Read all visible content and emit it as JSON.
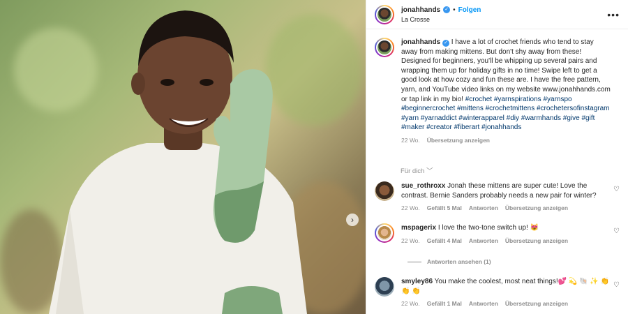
{
  "post": {
    "username": "jonahhands",
    "follow_label": "Folgen",
    "location": "La Crosse",
    "more_label": "•••",
    "caption_parts": {
      "text": "I have a lot of crochet friends who tend to stay away from making mittens. But don't shy away from these! Designed for beginners, you'll be whipping up several pairs and wrapping them up for holiday gifts in no time! Swipe left to get a good look at how cozy and fun these are. I have the free pattern, yarn, and YouTube video links on my website www.jonahhands.com or tap link in my bio!",
      "hashtags": "#crochet #yarnspirations #yarnspo #beginnercrochet #mittens #crochetmittens #crochetersofinstagram #yarn #yarnaddict #winterapparel #diy #warmhands #give #gift #maker #creator #fiberart #jonahhands"
    },
    "age": "22 Wo.",
    "translate_label": "Übersetzung anzeigen",
    "translate_toggle": "Für dich ﹀"
  },
  "comments": [
    {
      "username": "sue_rothroxx",
      "text": "Jonah these mittens are super cute! Love the contrast. Bernie Sanders probably needs a new pair for winter?",
      "age": "22 Wo.",
      "likes": "Gefällt 5 Mal",
      "reply_label": "Antworten",
      "translate_label": "Übersetzung anzeigen"
    },
    {
      "username": "mspagerix",
      "text": "I love the two-tone switch up! 😻",
      "age": "22 Wo.",
      "likes": "Gefällt 4 Mal",
      "reply_label": "Antworten",
      "translate_label": "Übersetzung anzeigen"
    },
    {
      "username": "smyley86",
      "text": "You make the coolest, most neat things!💕 💫 🐚 ✨ 👏 👏 👏",
      "age": "22 Wo.",
      "likes": "Gefällt 1 Mal",
      "reply_label": "Antworten",
      "translate_label": "Übersetzung anzeigen"
    }
  ],
  "view_replies_label": "Antworten ansehen (1)",
  "icons": {
    "next_arrow": "chevron-right-icon",
    "heart": "heart-icon",
    "verified": "verified-badge-icon"
  },
  "colors": {
    "link_blue": "#0095f6",
    "hashtag": "#00376b",
    "muted": "#8e8e8e",
    "text": "#262626"
  }
}
